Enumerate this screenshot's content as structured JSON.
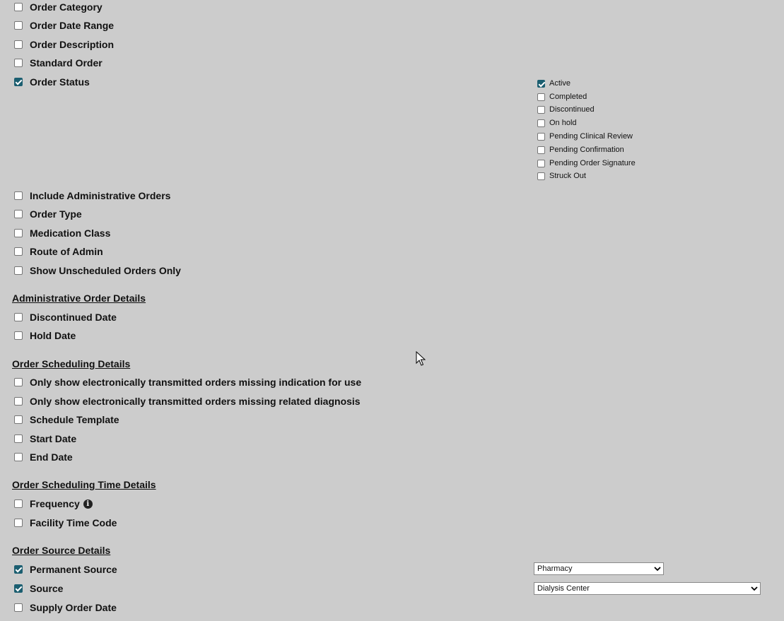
{
  "filters": [
    {
      "label": "Order Category",
      "checked": false
    },
    {
      "label": "Order Date Range",
      "checked": false
    },
    {
      "label": "Order Description",
      "checked": false
    },
    {
      "label": "Standard Order",
      "checked": false
    },
    {
      "label": "Order Status",
      "checked": true
    },
    {
      "label": "Include Administrative Orders",
      "checked": false
    },
    {
      "label": "Order Type",
      "checked": false
    },
    {
      "label": "Medication Class",
      "checked": false
    },
    {
      "label": "Route of Admin",
      "checked": false
    },
    {
      "label": "Show Unscheduled Orders Only",
      "checked": false
    }
  ],
  "status_options": [
    {
      "label": "Active",
      "checked": true
    },
    {
      "label": "Completed",
      "checked": false
    },
    {
      "label": "Discontinued",
      "checked": false
    },
    {
      "label": "On hold",
      "checked": false
    },
    {
      "label": "Pending Clinical Review",
      "checked": false
    },
    {
      "label": "Pending Confirmation",
      "checked": false
    },
    {
      "label": "Pending Order Signature",
      "checked": false
    },
    {
      "label": "Struck Out",
      "checked": false
    }
  ],
  "sections": {
    "admin": {
      "title": "Administrative Order Details",
      "items": [
        {
          "label": "Discontinued Date",
          "checked": false
        },
        {
          "label": "Hold Date",
          "checked": false
        }
      ]
    },
    "scheduling": {
      "title": "Order Scheduling Details",
      "items": [
        {
          "label": "Only show electronically transmitted orders missing indication for use",
          "checked": false
        },
        {
          "label": "Only show electronically transmitted orders missing related diagnosis",
          "checked": false
        },
        {
          "label": "Schedule Template",
          "checked": false
        },
        {
          "label": "Start Date",
          "checked": false
        },
        {
          "label": "End Date",
          "checked": false
        }
      ]
    },
    "time": {
      "title": "Order Scheduling Time Details",
      "items": [
        {
          "label": "Frequency",
          "checked": false
        },
        {
          "label": "Facility Time Code",
          "checked": false
        }
      ]
    },
    "source": {
      "title": "Order Source Details",
      "items": [
        {
          "label": "Permanent Source",
          "checked": true
        },
        {
          "label": "Source",
          "checked": true
        },
        {
          "label": "Supply Order Date",
          "checked": false
        }
      ]
    }
  },
  "selects": {
    "permanent_source": "Pharmacy",
    "source": "Dialysis Center"
  },
  "icons": {
    "frequency_info": "i"
  }
}
